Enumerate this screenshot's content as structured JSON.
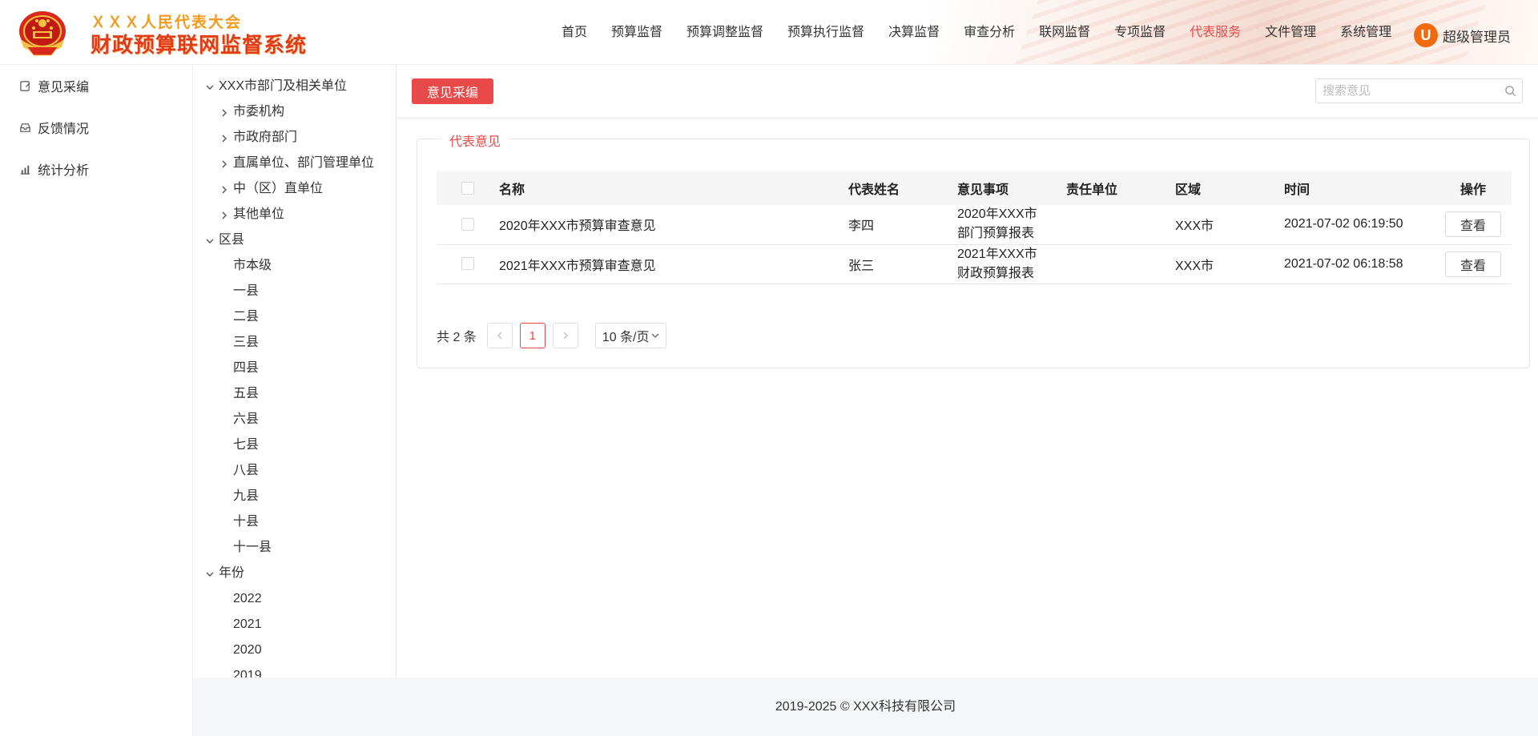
{
  "brand": {
    "line1": "ＸＸＸ人民代表大会",
    "line2": "财政预算联网监督系统"
  },
  "nav": {
    "items": [
      "首页",
      "预算监督",
      "预算调整监督",
      "预算执行监督",
      "决算监督",
      "审查分析",
      "联网监督",
      "专项监督",
      "代表服务",
      "文件管理",
      "系统管理"
    ],
    "active": "代表服务"
  },
  "user": {
    "avatar_letter": "U",
    "name": "超级管理员"
  },
  "leftmenu": {
    "items": [
      {
        "label": "意见采编",
        "icon": "edit-icon"
      },
      {
        "label": "反馈情况",
        "icon": "inbox-icon"
      },
      {
        "label": "统计分析",
        "icon": "chart-icon"
      }
    ]
  },
  "tree": {
    "dept_root": "XXX市部门及相关单位",
    "dept_children": [
      "市委机构",
      "市政府部门",
      "直属单位、部门管理单位",
      "中（区）直单位",
      "其他单位"
    ],
    "region_root": "区县",
    "region_children": [
      "市本级",
      "一县",
      "二县",
      "三县",
      "四县",
      "五县",
      "六县",
      "七县",
      "八县",
      "九县",
      "十县",
      "十一县"
    ],
    "year_root": "年份",
    "year_children": [
      "2022",
      "2021",
      "2020",
      "2019"
    ]
  },
  "toolbar": {
    "collect_button": "意见采编",
    "search_placeholder": "搜索意见"
  },
  "card": {
    "legend": "代表意见"
  },
  "table": {
    "headers": [
      "名称",
      "代表姓名",
      "意见事项",
      "责任单位",
      "区域",
      "时间",
      "操作"
    ],
    "rows": [
      {
        "name": "2020年XXX市预算审查意见",
        "rep": "李四",
        "matter_l1": "2020年XXX市",
        "matter_l2": "部门预算报表",
        "unit": "",
        "region": "XXX市",
        "time": "2021-07-02 06:19:50",
        "action": "查看"
      },
      {
        "name": "2021年XXX市预算审查意见",
        "rep": "张三",
        "matter_l1": "2021年XXX市",
        "matter_l2": "财政预算报表",
        "unit": "",
        "region": "XXX市",
        "time": "2021-07-02 06:18:58",
        "action": "查看"
      }
    ]
  },
  "pager": {
    "total": "共 2 条",
    "current": "1",
    "page_size": "10 条/页"
  },
  "footer": {
    "copyright": "2019-2025 © XXX科技有限公司"
  },
  "colors": {
    "accent": "#e84a4a",
    "avatar": "#f26a10",
    "brand_orange": "#f39a1c",
    "brand_red": "#e23b1b"
  }
}
